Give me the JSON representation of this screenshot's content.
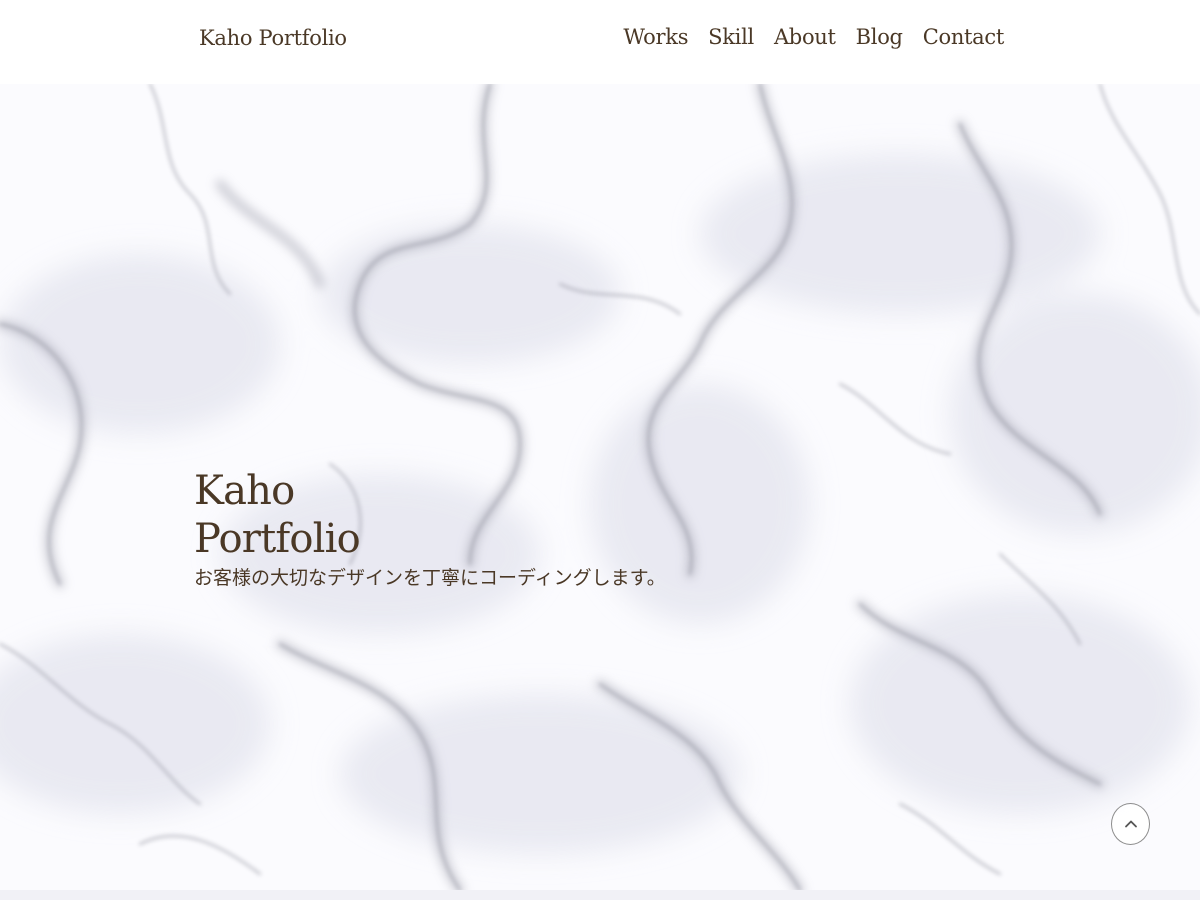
{
  "header": {
    "logo": "Kaho Portfolio",
    "nav": [
      {
        "label": "Works"
      },
      {
        "label": "Skill"
      },
      {
        "label": "About"
      },
      {
        "label": "Blog"
      },
      {
        "label": "Contact"
      }
    ]
  },
  "hero": {
    "title_line1": "Kaho",
    "title_line2": "Portfolio",
    "tagline": "お客様の大切なデザインを丁寧にコーディングします。",
    "background": "marble-texture"
  },
  "back_to_top": {
    "icon": "chevron-up-icon"
  },
  "colors": {
    "text": "#4a3826",
    "header_bg": "#ffffff",
    "marble_base": "#fbfbfe",
    "marble_vein": "#9a9aa6"
  }
}
